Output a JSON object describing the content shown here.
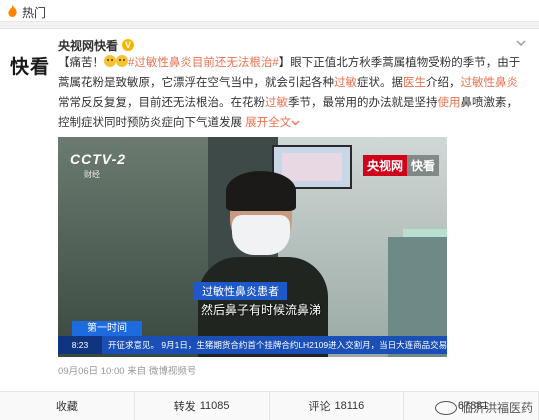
{
  "hot": {
    "label": "热门"
  },
  "post": {
    "author": "央视网快看",
    "avatar_text": "快看",
    "vip_badge": "V",
    "prefix": "【痛苦！",
    "hashtag": "#过敏性鼻炎目前还无法根治#",
    "text1": "】眼下正值北方秋季蒿属植物受粉的季节，由于蒿属花粉是致敏原，它漂浮在空气当中，就会引起各种",
    "kw_allergy": "过敏",
    "text2": "症状。据",
    "kw_doctor": "医生",
    "text3": "介绍，",
    "kw_rhinitis": "过敏性鼻炎",
    "text4": "常常反反复复，目前还无法根治。在花粉",
    "kw_allergy2": "过敏",
    "text5": "季节，最常用的办法就是坚持",
    "kw_use": "使用",
    "text6": "鼻喷激素，控制症状同时预防炎症向下气道发展",
    "expand": "展开全文",
    "expand_icon": "chevron-down-icon"
  },
  "video": {
    "channel": "CCTV-2",
    "channel_sub": "财经",
    "brand_a": "央视网",
    "brand_b": "快看",
    "caption_label": "过敏性鼻炎患者",
    "caption_text": "然后鼻子有时候流鼻涕",
    "program": "第一时间",
    "ticker_time": "8:23",
    "ticker_text": "开征求意见。   9月1日，生猪期货合约首个挂牌合约LH2109进入交割月，当日大连商品交易"
  },
  "meta": {
    "timestamp": "09月06日 10:00",
    "source": "来自 微博视频号"
  },
  "actions": {
    "favorite": "收藏",
    "repost": "转发",
    "repost_count": "11085",
    "comment": "评论",
    "comment_count": "18116",
    "like_count": "67881"
  },
  "watermark": {
    "text": "临沂洪福医药"
  },
  "colors": {
    "accent": "#eb7350",
    "vip": "#f7b500",
    "brand_red": "#d0021b",
    "news_blue": "#1a4fb8"
  }
}
